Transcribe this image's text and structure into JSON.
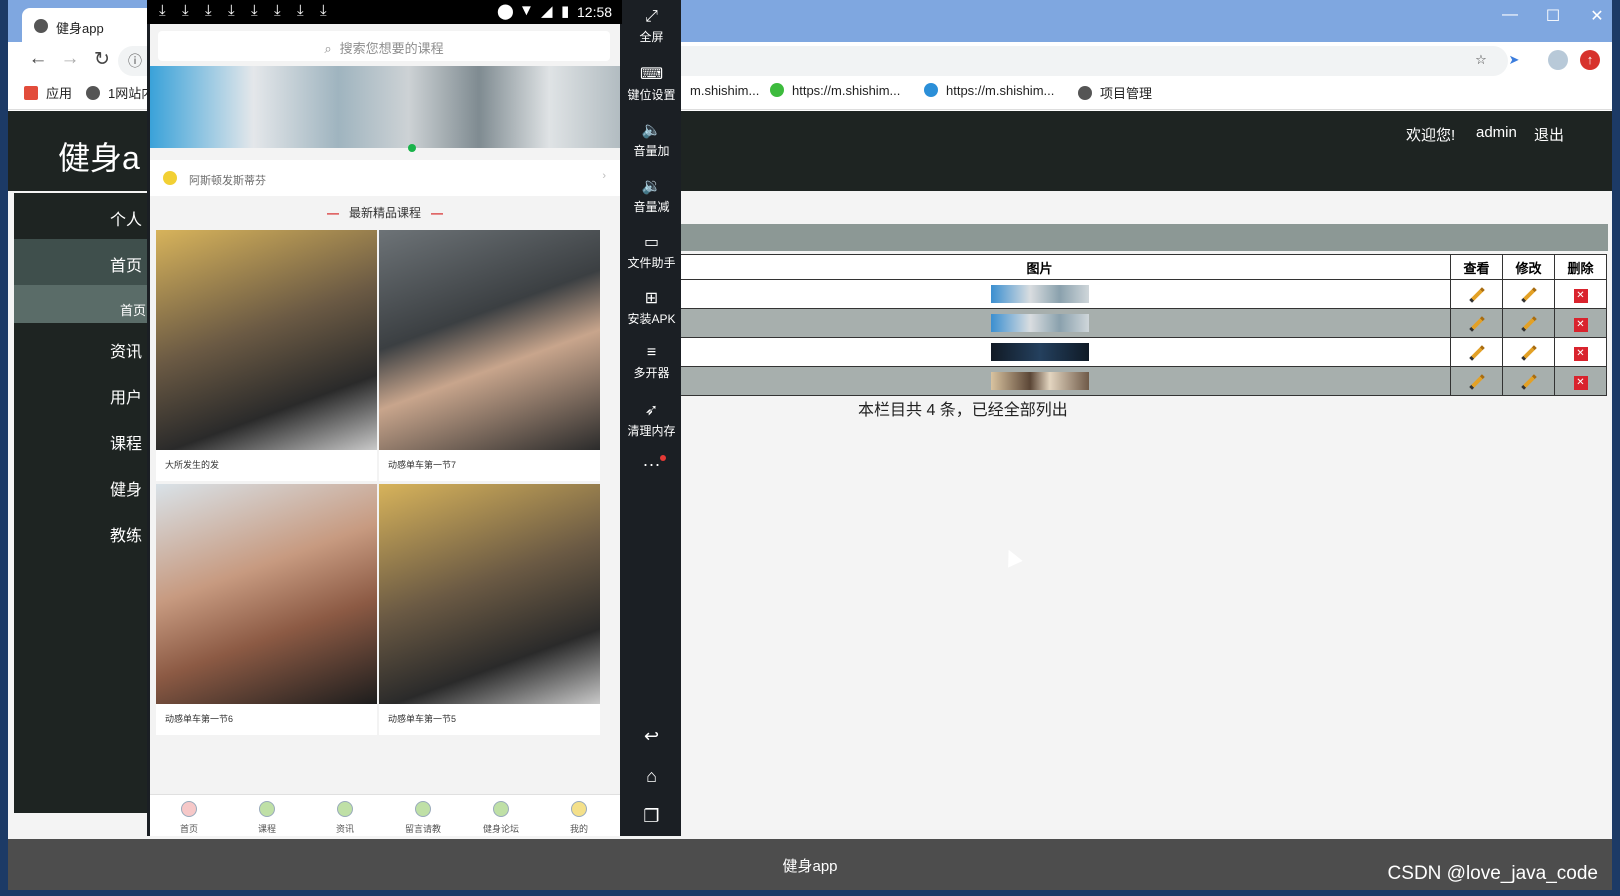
{
  "browser": {
    "tab_title": "健身app",
    "bookmarks": [
      "应用",
      "1网站内",
      "m.shishim...",
      "https://m.shishim...",
      "https://m.shishim...",
      "项目管理"
    ],
    "window_controls": {
      "minimize": "—",
      "maximize": "☐",
      "close": "✕"
    }
  },
  "site": {
    "title": "健身a",
    "welcome": "欢迎您!",
    "user": "admin",
    "logout": "退出",
    "footer": "健身app"
  },
  "sidebar": {
    "items": [
      "个人",
      "首页",
      "首页",
      "资讯",
      "用户",
      "课程",
      "健身",
      "教练"
    ]
  },
  "table": {
    "headers": {
      "image": "图片",
      "view": "查看",
      "edit": "修改",
      "delete": "删除"
    },
    "rows": [
      {
        "thumb_color": "#6fa6c8"
      },
      {
        "thumb_color": "#7fb2cf"
      },
      {
        "thumb_color": "#1d2a3a"
      },
      {
        "thumb_color": "#b08a62"
      }
    ],
    "summary": "本栏目共 4 条，已经全部列出"
  },
  "emulator": {
    "time": "12:58",
    "search_placeholder": "搜索您想要的课程",
    "notice": "阿斯顿发斯蒂芬",
    "section_title": "最新精品课程",
    "courses": [
      {
        "caption": "大所发生的发",
        "color": "#6b5a44"
      },
      {
        "caption": "动感单车第一节7",
        "color": "#5a5f63"
      },
      {
        "caption": "动感单车第一节6",
        "color": "#b38a74"
      },
      {
        "caption": "动感单车第一节5",
        "color": "#6b5a44"
      }
    ],
    "bottom_nav": [
      "首页",
      "课程",
      "资讯",
      "留言请教",
      "健身论坛",
      "我的"
    ],
    "tools": [
      "全屏",
      "键位设置",
      "音量加",
      "音量减",
      "文件助手",
      "安装APK",
      "多开器",
      "清理内存"
    ],
    "more": "···"
  },
  "watermark": "CSDN @love_java_code"
}
